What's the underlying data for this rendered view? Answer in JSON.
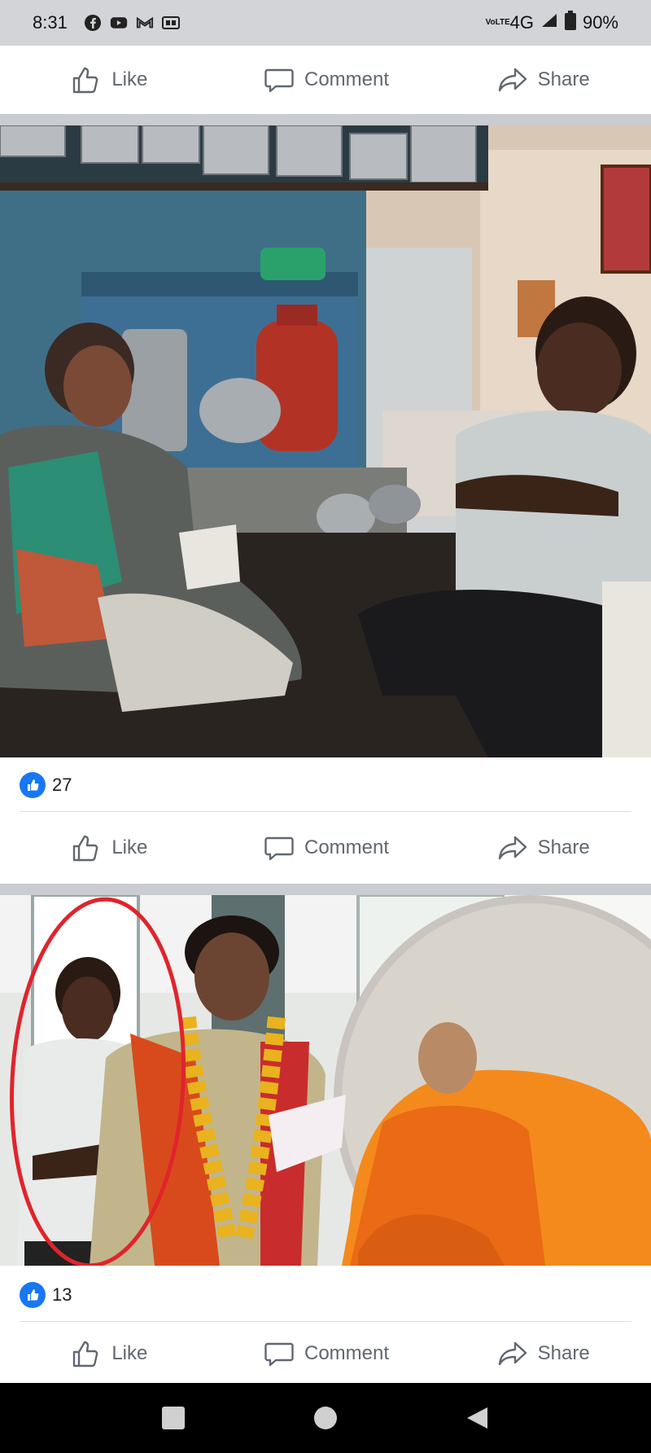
{
  "status_bar": {
    "time": "8:31",
    "left_icons": [
      "facebook-icon",
      "youtube-icon",
      "gmail-icon",
      "gb-icon"
    ],
    "network_label": "VoLTE",
    "network": "4G",
    "battery": "90%"
  },
  "actions": {
    "like": "Like",
    "comment": "Comment",
    "share": "Share"
  },
  "posts": [
    {
      "reaction_count": "27"
    },
    {
      "reaction_count": "13"
    }
  ],
  "colors": {
    "facebook_blue": "#1877f2",
    "action_gray": "#606770",
    "separator": "#c9ccd1",
    "annotation_circle": "#e0242c"
  }
}
